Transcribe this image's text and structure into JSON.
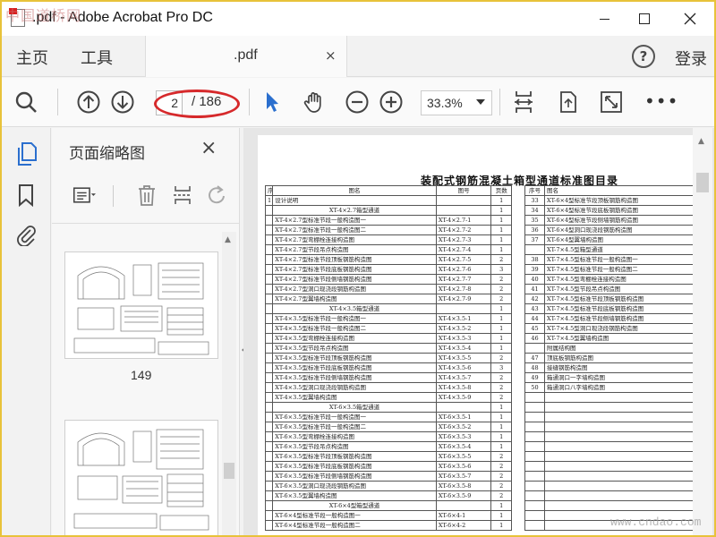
{
  "window": {
    "title": ".pdf - Adobe Acrobat Pro DC",
    "watermark_top": "中国道桥网"
  },
  "tabs": {
    "home": "主页",
    "tools": "工具",
    "doc_tab": ".pdf",
    "doc_tab_close": "×",
    "help": "?",
    "login": "登录"
  },
  "toolbar": {
    "current_page": "2",
    "total_pages": "/ 186",
    "zoom": "33.3%",
    "more": "•••"
  },
  "thumbnails": {
    "title": "页面缩略图",
    "close": "×",
    "page_label": "149"
  },
  "document": {
    "title": "装配式钢筋混凝土箱型通道标准图目录",
    "left_table": {
      "headers": [
        "序号",
        "图名",
        "图号",
        "页数"
      ],
      "rows": [
        [
          "1",
          "设计说明",
          "",
          "1"
        ],
        [
          "",
          "XT-4×2.7箱型通道",
          "",
          "1"
        ],
        [
          "",
          "XT-4×2.7型标准节段一般构造图一",
          "XT-4×2.7-1",
          "1"
        ],
        [
          "",
          "XT-4×2.7型标准节段一般构造图二",
          "XT-4×2.7-2",
          "1"
        ],
        [
          "",
          "XT-4×2.7型弯棚栓连接构造图",
          "XT-4×2.7-3",
          "1"
        ],
        [
          "",
          "XT-4×2.7型节段吊点构造图",
          "XT-4×2.7-4",
          "1"
        ],
        [
          "",
          "XT-4×2.7型标准节段顶板钢筋构造图",
          "XT-4×2.7-5",
          "2"
        ],
        [
          "",
          "XT-4×2.7型标准节段底板钢筋构造图",
          "XT-4×2.7-6",
          "3"
        ],
        [
          "",
          "XT-4×2.7型标准节段侧墙钢筋构造图",
          "XT-4×2.7-7",
          "2"
        ],
        [
          "",
          "XT-4×2.7型洞口现浇段钢筋构造图",
          "XT-4×2.7-8",
          "2"
        ],
        [
          "",
          "XT-4×2.7型翼墙构造图",
          "XT-4×2.7-9",
          "2"
        ],
        [
          "",
          "XT-4×3.5箱型通道",
          "",
          "1"
        ],
        [
          "",
          "XT-4×3.5型标准节段一般构造图一",
          "XT-4×3.5-1",
          "1"
        ],
        [
          "",
          "XT-4×3.5型标准节段一般构造图二",
          "XT-4×3.5-2",
          "1"
        ],
        [
          "",
          "XT-4×3.5型弯棚栓连接构造图",
          "XT-4×3.5-3",
          "1"
        ],
        [
          "",
          "XT-4×3.5型节段吊点构造图",
          "XT-4×3.5-4",
          "1"
        ],
        [
          "",
          "XT-4×3.5型标准节段顶板钢筋构造图",
          "XT-4×3.5-5",
          "2"
        ],
        [
          "",
          "XT-4×3.5型标准节段底板钢筋构造图",
          "XT-4×3.5-6",
          "3"
        ],
        [
          "",
          "XT-4×3.5型标准节段侧墙钢筋构造图",
          "XT-4×3.5-7",
          "2"
        ],
        [
          "",
          "XT-4×3.5型洞口现浇段钢筋构造图",
          "XT-4×3.5-8",
          "2"
        ],
        [
          "",
          "XT-4×3.5型翼墙构造图",
          "XT-4×3.5-9",
          "2"
        ],
        [
          "",
          "XT-6×3.5箱型通道",
          "",
          "1"
        ],
        [
          "",
          "XT-6×3.5型标准节段一般构造图一",
          "XT-6×3.5-1",
          "1"
        ],
        [
          "",
          "XT-6×3.5型标准节段一般构造图二",
          "XT-6×3.5-2",
          "1"
        ],
        [
          "",
          "XT-6×3.5型弯棚栓连接构造图",
          "XT-6×3.5-3",
          "1"
        ],
        [
          "",
          "XT-6×3.5型节段吊点构造图",
          "XT-6×3.5-4",
          "1"
        ],
        [
          "",
          "XT-6×3.5型标准节段顶板钢筋构造图",
          "XT-6×3.5-5",
          "2"
        ],
        [
          "",
          "XT-6×3.5型标准节段底板钢筋构造图",
          "XT-6×3.5-6",
          "2"
        ],
        [
          "",
          "XT-6×3.5型标准节段侧墙钢筋构造图",
          "XT-6×3.5-7",
          "2"
        ],
        [
          "",
          "XT-6×3.5型洞口现浇段钢筋构造图",
          "XT-6×3.5-8",
          "2"
        ],
        [
          "",
          "XT-6×3.5型翼墙构造图",
          "XT-6×3.5-9",
          "2"
        ],
        [
          "",
          "XT-6×4型箱型通道",
          "",
          "1"
        ],
        [
          "",
          "XT-6×4型标准节段一般构造图一",
          "XT-6×4-1",
          "1"
        ],
        [
          "",
          "XT-6×4型标准节段一般构造图二",
          "XT-6×4-2",
          "1"
        ]
      ]
    },
    "right_table": {
      "headers": [
        "序号",
        "图名"
      ],
      "rows": [
        [
          "33",
          "XT-6×4型标准节段顶板钢筋构造图"
        ],
        [
          "34",
          "XT-6×4型标准节段底板钢筋构造图"
        ],
        [
          "35",
          "XT-6×4型标准节段侧墙钢筋构造图"
        ],
        [
          "36",
          "XT-6×4型洞口现浇段钢筋构造图"
        ],
        [
          "37",
          "XT-6×4型翼墙构造图"
        ],
        [
          "",
          "XT-7×4.5型箱型通道"
        ],
        [
          "38",
          "XT-7×4.5型标准节段一般构造图一"
        ],
        [
          "39",
          "XT-7×4.5型标准节段一般构造图二"
        ],
        [
          "40",
          "XT-7×4.5型弯棚栓连接构造图"
        ],
        [
          "41",
          "XT-7×4.5型节段吊点构造图"
        ],
        [
          "42",
          "XT-7×4.5型标准节段顶板钢筋构造图"
        ],
        [
          "43",
          "XT-7×4.5型标准节段底板钢筋构造图"
        ],
        [
          "44",
          "XT-7×4.5型标准节段侧墙钢筋构造图"
        ],
        [
          "45",
          "XT-7×4.5型洞口现浇段钢筋构造图"
        ],
        [
          "46",
          "XT-7×4.5型翼墙构造图"
        ],
        [
          "",
          "附属结构图"
        ],
        [
          "47",
          "顶底板钢筋构造图"
        ],
        [
          "48",
          "接缝钢筋构造图"
        ],
        [
          "49",
          "箱通洞口一字墙构造图"
        ],
        [
          "50",
          "箱通洞口八字墙构造图"
        ],
        [
          "",
          ""
        ],
        [
          "",
          ""
        ],
        [
          "",
          ""
        ],
        [
          "",
          ""
        ],
        [
          "",
          ""
        ],
        [
          "",
          ""
        ],
        [
          "",
          ""
        ],
        [
          "",
          ""
        ],
        [
          "",
          ""
        ],
        [
          "",
          ""
        ],
        [
          "",
          ""
        ],
        [
          "",
          ""
        ],
        [
          "",
          ""
        ],
        [
          "",
          ""
        ]
      ]
    }
  },
  "watermark_bottom": "www.cndao.com",
  "colors": {
    "frame_border": "#e8c23a",
    "annotation_ellipse": "#d6292b",
    "accent_blue": "#2b6fce"
  }
}
